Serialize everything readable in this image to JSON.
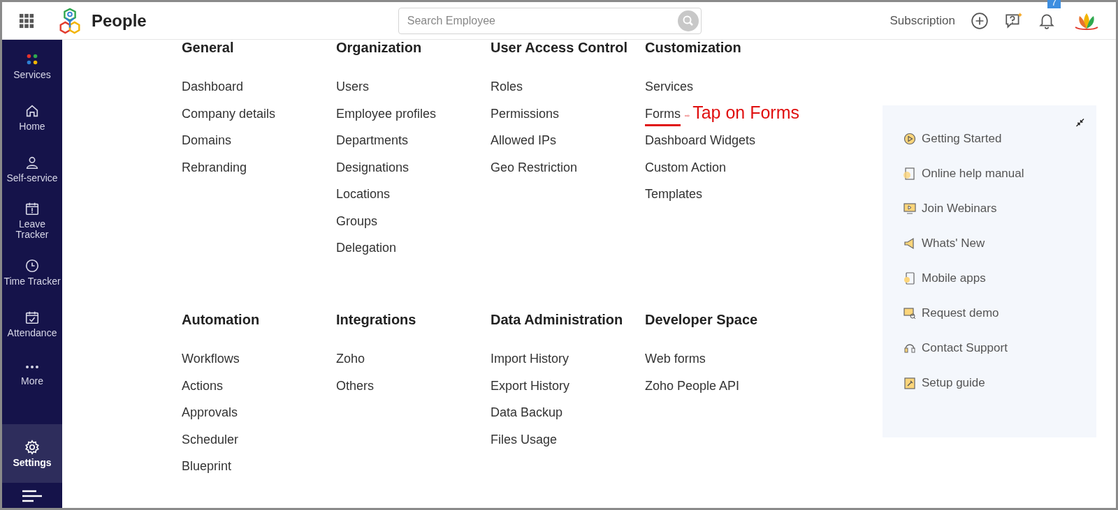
{
  "header": {
    "app_name": "People",
    "search": {
      "placeholder": "Search Employee"
    },
    "subscription": "Subscription",
    "notification_count": "7"
  },
  "sidebar": {
    "items": [
      {
        "label": "Services",
        "selected": false
      },
      {
        "label": "Home",
        "selected": false
      },
      {
        "label": "Self-service",
        "selected": false
      },
      {
        "label": "Leave Tracker",
        "selected": false
      },
      {
        "label": "Time Tracker",
        "selected": false
      },
      {
        "label": "Attendance",
        "selected": false
      },
      {
        "label": "More",
        "selected": false
      },
      {
        "label": "Settings",
        "selected": true
      }
    ]
  },
  "settings_sections": [
    {
      "title": "General",
      "items": [
        {
          "label": "Dashboard",
          "marked": false
        },
        {
          "label": "Company details",
          "marked": false
        },
        {
          "label": "Domains",
          "marked": false
        },
        {
          "label": "Rebranding",
          "marked": false
        }
      ]
    },
    {
      "title": "Organization",
      "items": [
        {
          "label": "Users",
          "marked": false
        },
        {
          "label": "Employee profiles",
          "marked": false
        },
        {
          "label": "Departments",
          "marked": false
        },
        {
          "label": "Designations",
          "marked": false
        },
        {
          "label": "Locations",
          "marked": false
        },
        {
          "label": "Groups",
          "marked": false
        },
        {
          "label": "Delegation",
          "marked": false
        }
      ]
    },
    {
      "title": "User Access Control",
      "items": [
        {
          "label": "Roles",
          "marked": false
        },
        {
          "label": "Permissions",
          "marked": false
        },
        {
          "label": "Allowed IPs",
          "marked": false
        },
        {
          "label": "Geo Restriction",
          "marked": false
        }
      ]
    },
    {
      "title": "Customization",
      "items": [
        {
          "label": "Services",
          "marked": false
        },
        {
          "label": "Forms",
          "marked": true
        },
        {
          "label": "Dashboard Widgets",
          "marked": false
        },
        {
          "label": "Custom Action",
          "marked": false
        },
        {
          "label": "Templates",
          "marked": false
        }
      ]
    },
    {
      "title": "Automation",
      "items": [
        {
          "label": "Workflows",
          "marked": false
        },
        {
          "label": "Actions",
          "marked": false
        },
        {
          "label": "Approvals",
          "marked": false
        },
        {
          "label": "Scheduler",
          "marked": false
        },
        {
          "label": "Blueprint",
          "marked": false
        }
      ]
    },
    {
      "title": "Integrations",
      "items": [
        {
          "label": "Zoho",
          "marked": false
        },
        {
          "label": "Others",
          "marked": false
        }
      ]
    },
    {
      "title": "Data Administration",
      "items": [
        {
          "label": "Import History",
          "marked": false
        },
        {
          "label": "Export History",
          "marked": false
        },
        {
          "label": "Data Backup",
          "marked": false
        },
        {
          "label": "Files Usage",
          "marked": false
        }
      ]
    },
    {
      "title": "Developer Space",
      "items": [
        {
          "label": "Web forms",
          "marked": false
        },
        {
          "label": "Zoho People API",
          "marked": false
        }
      ]
    }
  ],
  "annotation": {
    "text": "Tap on Forms"
  },
  "help_panel": {
    "items": [
      "Getting Started",
      "Online help manual",
      "Join Webinars",
      "Whats' New",
      "Mobile apps",
      "Request demo",
      "Contact Support",
      "Setup guide"
    ]
  }
}
